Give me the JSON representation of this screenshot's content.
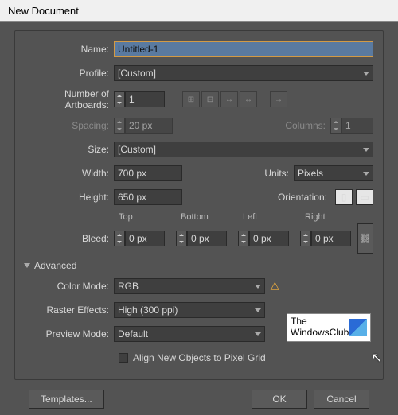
{
  "title": "New Document",
  "labels": {
    "name": "Name:",
    "profile": "Profile:",
    "artboards": "Number of Artboards:",
    "spacing": "Spacing:",
    "columns": "Columns:",
    "size": "Size:",
    "width": "Width:",
    "height": "Height:",
    "units": "Units:",
    "orientation": "Orientation:",
    "bleed": "Bleed:",
    "top": "Top",
    "bottom": "Bottom",
    "left": "Left",
    "right": "Right",
    "advanced": "Advanced",
    "colormode": "Color Mode:",
    "raster": "Raster Effects:",
    "preview": "Preview Mode:",
    "align": "Align New Objects to Pixel Grid"
  },
  "values": {
    "name": "Untitled-1",
    "profile": "[Custom]",
    "artboards": "1",
    "spacing": "20 px",
    "columns": "1",
    "size": "[Custom]",
    "width": "700 px",
    "height": "650 px",
    "units": "Pixels",
    "bleed_top": "0 px",
    "bleed_bottom": "0 px",
    "bleed_left": "0 px",
    "bleed_right": "0 px",
    "colormode": "RGB",
    "raster": "High (300 ppi)",
    "preview": "Default",
    "align_checked": false
  },
  "buttons": {
    "templates": "Templates...",
    "ok": "OK",
    "cancel": "Cancel"
  },
  "logo": {
    "line1": "The",
    "line2": "WindowsClub"
  }
}
